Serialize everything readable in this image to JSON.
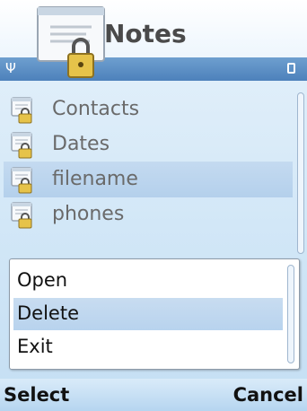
{
  "header": {
    "app_title": "Notes",
    "app_icon": "locked-notepad-icon",
    "signal_icon": "signal-antenna-icon",
    "battery_icon": "battery-icon"
  },
  "notes": {
    "items": [
      {
        "label": "Contacts",
        "icon": "locked-note-icon",
        "selected": false
      },
      {
        "label": "Dates",
        "icon": "locked-note-icon",
        "selected": false
      },
      {
        "label": "filename",
        "icon": "locked-note-icon",
        "selected": true
      },
      {
        "label": "phones",
        "icon": "locked-note-icon",
        "selected": false
      }
    ]
  },
  "menu": {
    "items": [
      {
        "label": "Open",
        "highlighted": false
      },
      {
        "label": "Delete",
        "highlighted": true
      },
      {
        "label": "Exit",
        "highlighted": false
      }
    ]
  },
  "softkeys": {
    "left": "Select",
    "right": "Cancel"
  },
  "colors": {
    "title_strip": "#4d81bb",
    "selection": "#b8d3ee",
    "background": "#d2e7f7"
  }
}
